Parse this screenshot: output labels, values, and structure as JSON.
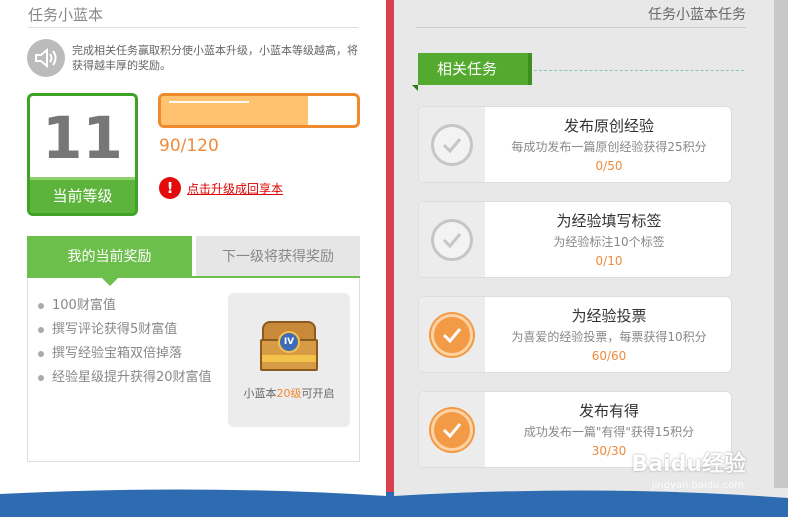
{
  "left": {
    "title": "任务小蓝本",
    "intro": "完成相关任务赢取积分使小蓝本升级，小蓝本等级越高，将获得越丰厚的奖励。",
    "level": {
      "number": "11",
      "label": "当前等级"
    },
    "progress": {
      "text": "90/120",
      "current": 90,
      "max": 120
    },
    "upgrade_link": "点击升级成回享本",
    "tabs": {
      "current": "我的当前奖励",
      "next": "下一级将获得奖励"
    },
    "rewards": [
      "100财富值",
      "撰写评论获得5财富值",
      "撰写经验宝箱双倍掉落",
      "经验星级提升获得20财富值"
    ],
    "chest": {
      "badge": "IV",
      "caption_prefix": "小蓝本",
      "caption_level": "20级",
      "caption_suffix": "可开启"
    }
  },
  "right": {
    "title": "任务小蓝本任务",
    "section_label": "相关任务",
    "tasks": [
      {
        "title": "发布原创经验",
        "desc": "每成功发布一篇原创经验获得25积分",
        "progress": "0/50",
        "done": false
      },
      {
        "title": "为经验填写标签",
        "desc": "为经验标注10个标签",
        "progress": "0/10",
        "done": false
      },
      {
        "title": "为经验投票",
        "desc": "为喜爱的经验投票，每票获得10积分",
        "progress": "60/60",
        "done": true
      },
      {
        "title": "发布有得",
        "desc": "成功发布一篇\"有得\"获得15积分",
        "progress": "30/30",
        "done": true
      }
    ]
  },
  "watermark": {
    "main": "Baidu经验",
    "sub": "jingyan.baidu.com"
  },
  "colors": {
    "green": "#5cb43c",
    "orange": "#f08a2e",
    "red": "#d94150",
    "blue": "#2e6bb0"
  }
}
